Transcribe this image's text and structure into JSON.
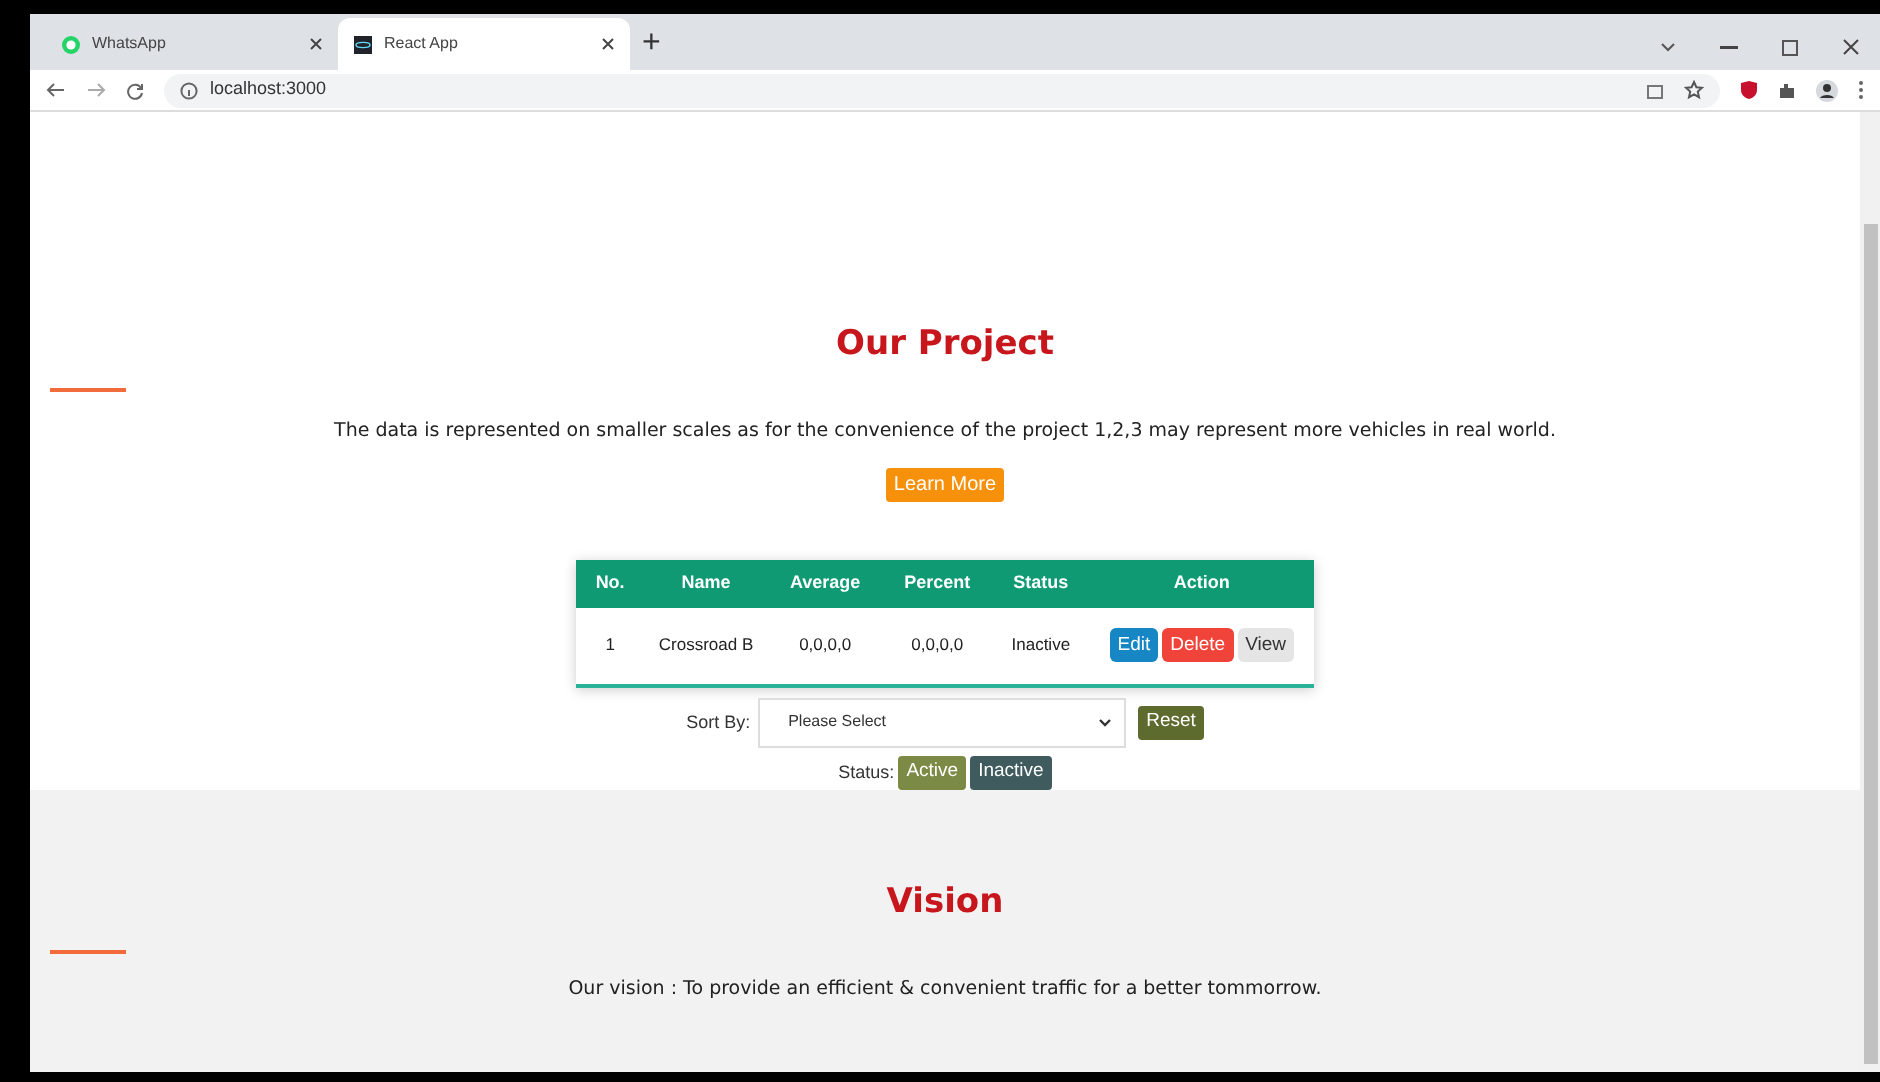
{
  "browser": {
    "tabs": [
      {
        "title": "WhatsApp",
        "selected": false,
        "kind": "whatsapp"
      },
      {
        "title": "React App",
        "selected": true,
        "kind": "react"
      }
    ],
    "new_tab": "+",
    "address": "localhost:3000"
  },
  "project": {
    "title": "Our Project",
    "description": "The data is represented on smaller scales as for the convenience of the project 1,2,3 may represent more vehicles in real world.",
    "button": "Learn More"
  },
  "table": {
    "columns": [
      "No.",
      "Name",
      "Average",
      "Percent",
      "Status",
      "Action"
    ],
    "rows": [
      {
        "cells": [
          "1",
          "Crossroad B",
          "0,0,0,0",
          "0,0,0,0",
          "Inactive"
        ],
        "actions": [
          {
            "label": "Edit",
            "kind": "edit"
          },
          {
            "label": "Delete",
            "kind": "delete"
          },
          {
            "label": "View",
            "kind": "view"
          }
        ]
      }
    ]
  },
  "sort": {
    "label": "Sort By:",
    "placeholder": "Please Select",
    "reset": "Reset"
  },
  "status": {
    "label": "Status:",
    "filters": [
      {
        "label": "Active",
        "color": "#7b8a45"
      },
      {
        "label": "Inactive",
        "color": "#3f5b5d"
      }
    ]
  },
  "vision": {
    "title": "Vision",
    "text": "Our vision : To provide an efficient & convenient traffic for a better tommorrow."
  }
}
